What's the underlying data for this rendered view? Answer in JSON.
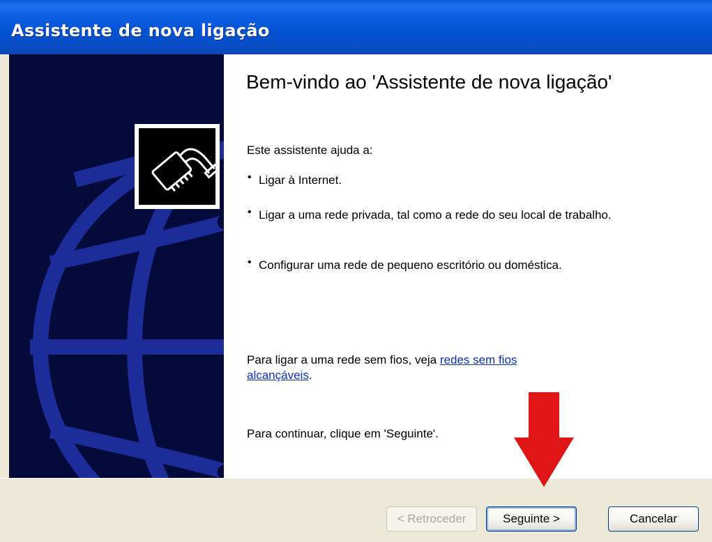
{
  "window": {
    "title": "Assistente de nova ligação"
  },
  "content": {
    "heading": "Bem-vindo ao 'Assistente de nova ligação'",
    "intro": "Este assistente ajuda a:",
    "bullets": [
      "Ligar à Internet.",
      "Ligar a uma rede privada, tal como a rede do seu local de trabalho.",
      "Configurar uma rede de pequeno escritório ou doméstica."
    ],
    "wireless_text": "Para ligar a uma rede sem fios, veja",
    "wireless_link": "redes sem fios alcançáveis",
    "wireless_suffix": ".",
    "continue_text": "Para continuar, clique em 'Seguinte'."
  },
  "buttons": {
    "back": "< Retroceder",
    "next": "Seguinte >",
    "cancel": "Cancelar"
  },
  "icons": {
    "logo": "network-cable-icon",
    "annotation": "red-down-arrow"
  },
  "colors": {
    "titlebar": "#0352d2",
    "sidebar": "#040a3a",
    "globe": "#1c2d9a",
    "link": "#0a2fb4",
    "arrow": "#e01515"
  }
}
